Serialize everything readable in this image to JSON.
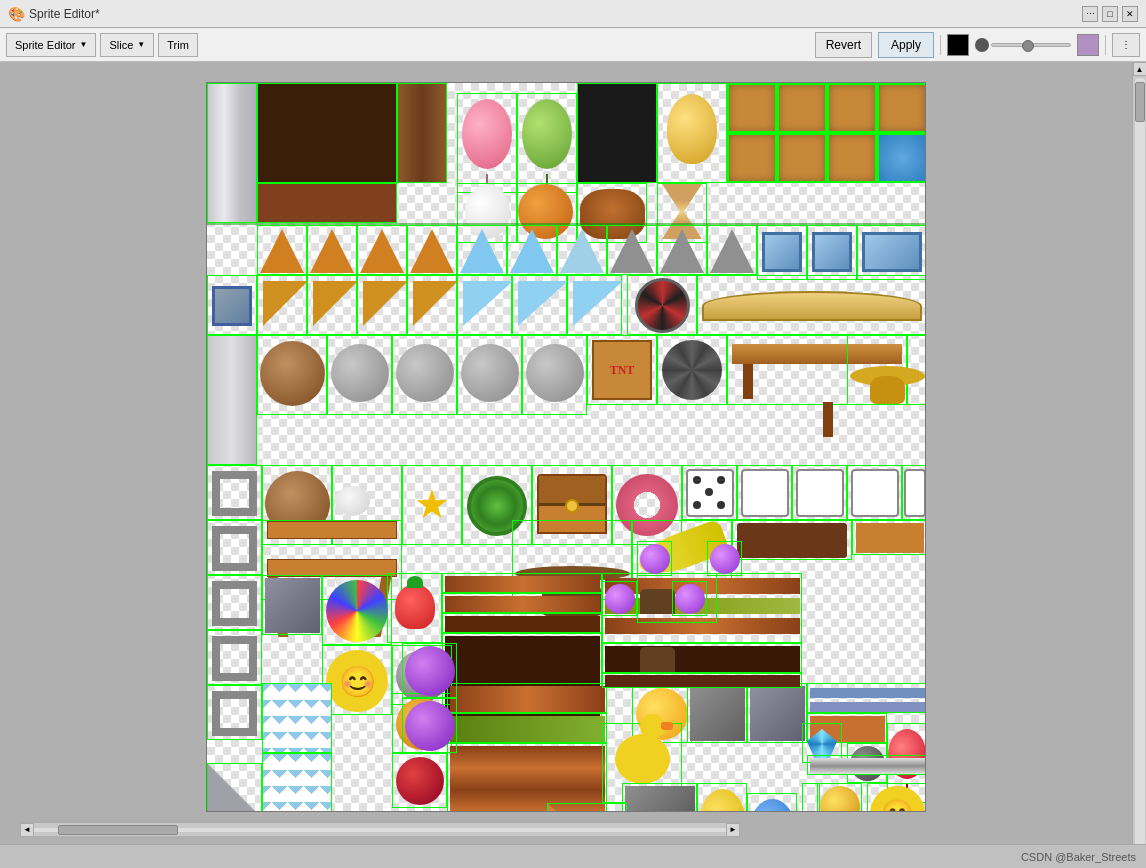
{
  "titleBar": {
    "title": "Sprite Editor*",
    "controls": [
      "...",
      "□",
      "✕"
    ]
  },
  "toolbar": {
    "spriteEditorLabel": "Sprite Editor",
    "sliceLabel": "Slice",
    "trimLabel": "Trim",
    "revertLabel": "Revert",
    "applyLabel": "Apply"
  },
  "bottomBar": {
    "credit": "CSDN @Baker_Streets"
  },
  "scrollbar": {
    "upArrow": "▲",
    "downArrow": "▼",
    "leftArrow": "◄",
    "rightArrow": "►"
  }
}
